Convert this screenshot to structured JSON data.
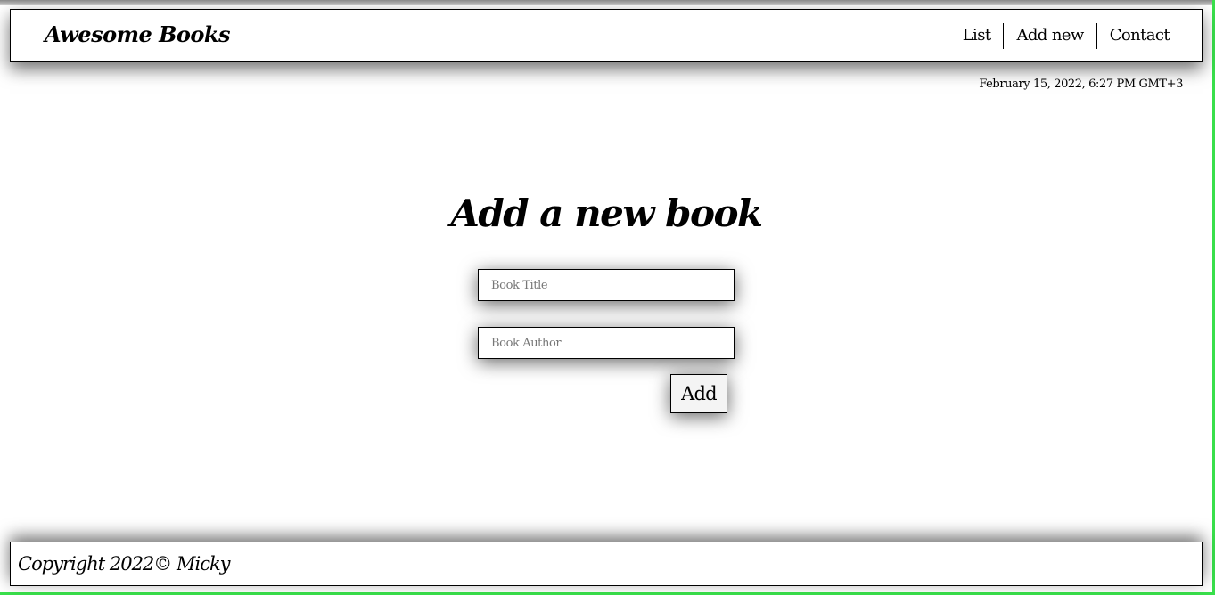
{
  "header": {
    "brand": "Awesome Books",
    "nav": [
      {
        "label": "List"
      },
      {
        "label": "Add new"
      },
      {
        "label": "Contact"
      }
    ]
  },
  "datetime": "February 15, 2022, 6:27 PM GMT+3",
  "form": {
    "heading": "Add a new book",
    "title_placeholder": "Book Title",
    "title_value": "",
    "author_placeholder": "Book Author",
    "author_value": "",
    "add_label": "Add"
  },
  "footer": {
    "copyright": "Copyright 2022© Micky"
  },
  "colors": {
    "page_background": "#ffffff",
    "border": "#000000",
    "accent_edge": "#39e04b"
  }
}
